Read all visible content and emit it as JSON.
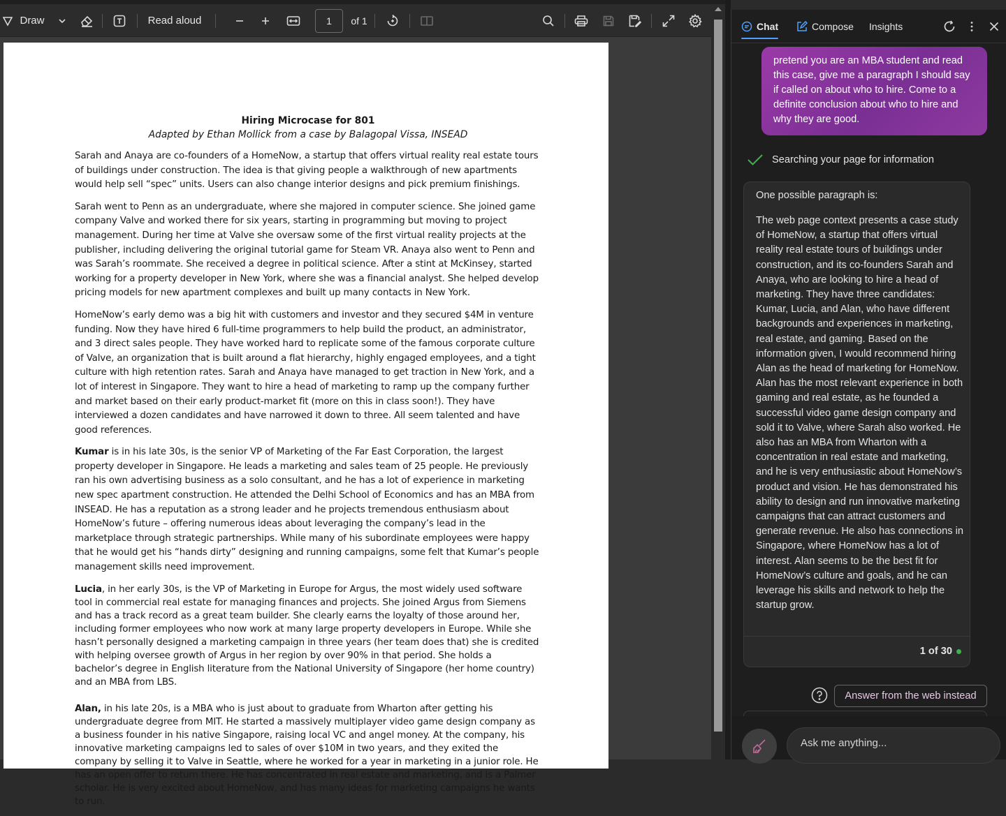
{
  "toolbar": {
    "draw_label": "Draw",
    "read_aloud_label": "Read aloud",
    "page_number": "1",
    "page_count": "of 1"
  },
  "document": {
    "title": "Hiring Microcase for 801",
    "subtitle": "Adapted by Ethan Mollick from a case by  Balagopal Vissa, INSEAD",
    "paragraph_1": "Sarah and Anaya are co-founders of a HomeNow, a startup that offers virtual reality real estate tours of buildings under construction.  The idea is that giving people a walkthrough of new apartments would help sell “spec” units.  Users can also change interior designs and pick premium finishings.",
    "paragraph_2": "Sarah went to Penn as an undergraduate, where she majored in computer science.  She joined game company Valve and worked there for six years, starting in programming but moving to project management.  During her time at Valve she oversaw some of the first virtual reality projects at the publisher, including delivering the original tutorial game for Steam VR. Anaya also went to Penn and was Sarah’s roommate.  She received a degree in political science.  After a stint at McKinsey, started working for a property developer in New York, where she was a financial analyst.  She helped develop pricing models for new apartment complexes and built up many contacts in New York.",
    "paragraph_3": "HomeNow’s early demo was a big hit with customers and investor and they secured $4M in venture funding. Now they have hired 6 full-time programmers to help build the product, an administrator, and 3 direct sales people. They have worked hard to replicate some of the famous corporate culture of Valve, an organization that is built around a flat hierarchy, highly engaged employees, and a tight culture with high retention rates.  Sarah and Anaya have managed to get traction in New York, and a lot of interest in Singapore.  They want to hire a head of marketing to ramp up the company further and market based on their early product-market fit (more on this in class soon!). They have interviewed a dozen candidates and have narrowed it down to three. All seem talented and have good references.",
    "kumar_name": "Kumar",
    "kumar_text": " is in his late 30s, is the senior VP of Marketing of the Far East Corporation, the largest property developer in Singapore.  He leads a marketing and sales team of 25 people.  He previously ran his own advertising business as a solo consultant, and he has a lot of experience in marketing new spec apartment construction. He attended the Delhi School of Economics and has an MBA from INSEAD. He has a reputation as a strong leader and he projects tremendous enthusiasm about HomeNow’s future – offering numerous ideas about leveraging the company’s lead in the marketplace through strategic partnerships.  While many of his subordinate employees were happy that he would get his “hands dirty” designing and running campaigns, some felt that Kumar’s people management skills need improvement.",
    "lucia_name": "Lucia",
    "lucia_text": ", in her early 30s, is the VP of Marketing in Europe for Argus, the most widely used software tool in commercial real estate for managing finances and projects. She joined Argus from Siemens and has a track record as a great team builder.  She clearly earns the loyalty of those around her, including former employees who now work at many large property developers in Europe.  While she hasn’t personally designed a marketing campaign in three years (her team does that) she is credited with helping oversee growth of Argus in her region by over 90% in that period. She holds a bachelor’s degree in English literature from the National University of Singapore (her home country) and an MBA from LBS.",
    "alan_name": "Alan,",
    "alan_text": " in his late 20s, is a MBA who is just about to graduate from Wharton after getting his undergraduate degree from MIT.  He started a massively multiplayer video game design company as a business founder in his native Singapore, raising local VC and angel money.  At the company, his innovative marketing campaigns led to sales of over $10M in two years, and they exited the company by selling it to Valve in Seattle, where he worked for a year in marketing in a junior role.  He has an open offer to return there. He has concentrated in real estate and marketing, and is a Palmer scholar. He is very excited about HomeNow, and has many ideas for marketing campaigns he wants to run."
  },
  "sidebar": {
    "tabs": [
      "Chat",
      "Compose",
      "Insights"
    ],
    "active_tab": "Chat",
    "user_message": "pretend you are an MBA student and read this case, give me a paragraph I should say if called on about who to hire. Come to a definite conclusion about who to hire and why they are good.",
    "status_text": "Searching your page for information",
    "answer_intro": "One possible paragraph is:",
    "answer_body": "The web page context presents a case study of HomeNow, a startup that offers virtual reality real estate tours of buildings under construction, and its co-founders Sarah and Anaya, who are looking to hire a head of marketing. They have three candidates: Kumar, Lucia, and Alan, who have different backgrounds and experiences in marketing, real estate, and gaming. Based on the information given, I would recommend hiring Alan as the head of marketing for HomeNow. Alan has the most relevant experience in both gaming and real estate, as he founded a successful video game design company and sold it to Valve, where Sarah also worked. He also has an MBA from Wharton with a concentration in real estate and marketing, and he is very enthusiastic about HomeNow’s product and vision. He has demonstrated his ability to design and run innovative marketing campaigns that can attract customers and generate revenue. He also has connections in Singapore, where HomeNow has a lot of interest. Alan seems to be the best fit for HomeNow’s culture and goals, and he can leverage his skills and network to help the startup grow.",
    "response_counter": "1 of 30",
    "web_button_label": "Answer from the web instead",
    "ask_placeholder": "Ask me anything..."
  },
  "colors": {
    "accent_blue": "#4ea1ff",
    "user_bubble": "#8e3a9f",
    "status_green": "#3bb54a"
  }
}
